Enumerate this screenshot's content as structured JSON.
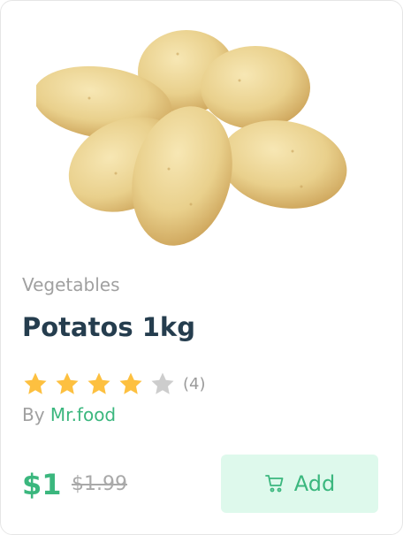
{
  "product": {
    "category": "Vegetables",
    "name": "Potatos 1kg",
    "rating": {
      "stars": 4,
      "max_stars": 5,
      "count_label": "(4)"
    },
    "vendor": {
      "prefix": "By",
      "name": "Mr.food"
    },
    "price": "$1",
    "old_price": "$1.99",
    "add_label": "Add"
  },
  "icons": {
    "star": "star-icon",
    "cart": "cart-icon"
  },
  "colors": {
    "accent": "#3bb77e",
    "star_filled": "#fdc040",
    "star_empty": "#cdcdcd",
    "title": "#253d4e",
    "add_button_bg": "#def9ec"
  }
}
